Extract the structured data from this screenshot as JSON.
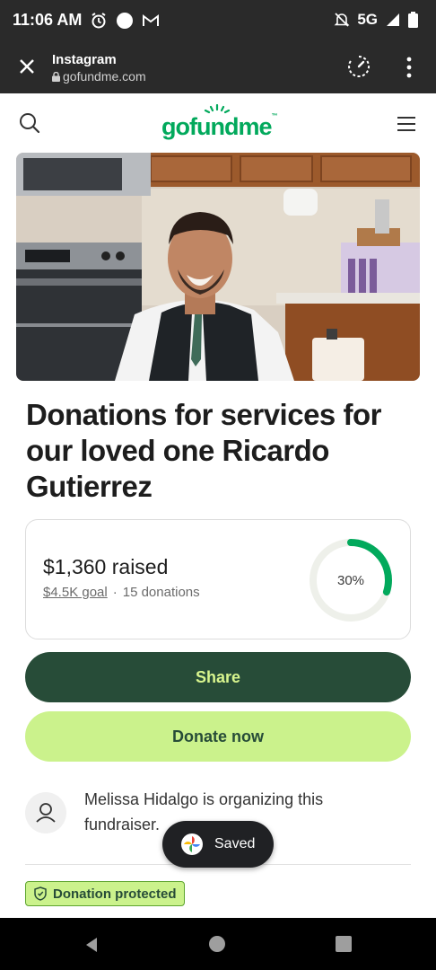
{
  "status_bar": {
    "time": "11:06 AM",
    "network": "5G",
    "icons": [
      "alarm-icon",
      "dot-icon",
      "gmail-icon",
      "mute-icon",
      "signal-icon",
      "battery-icon"
    ]
  },
  "browser": {
    "title": "Instagram",
    "url": "gofundme.com"
  },
  "header": {
    "logo": "gofundme",
    "logo_tm": "™"
  },
  "campaign": {
    "title": "Donations for services for our loved one Ricardo Gutierrez",
    "raised": "$1,360 raised",
    "goal": "$4.5K goal",
    "separator": "·",
    "donations": "15 donations",
    "progress_label": "30%",
    "progress_fraction": 0.3
  },
  "actions": {
    "share_label": "Share",
    "donate_label": "Donate now"
  },
  "organizer": {
    "text": "Melissa Hidalgo is organizing this fundraiser."
  },
  "badge": {
    "protected_label": "Donation protected"
  },
  "toast": {
    "label": "Saved"
  },
  "colors": {
    "brand_green": "#02a95c",
    "dark_green": "#274c38",
    "lime": "#cbf28c",
    "ring_track": "#eef0ea"
  }
}
